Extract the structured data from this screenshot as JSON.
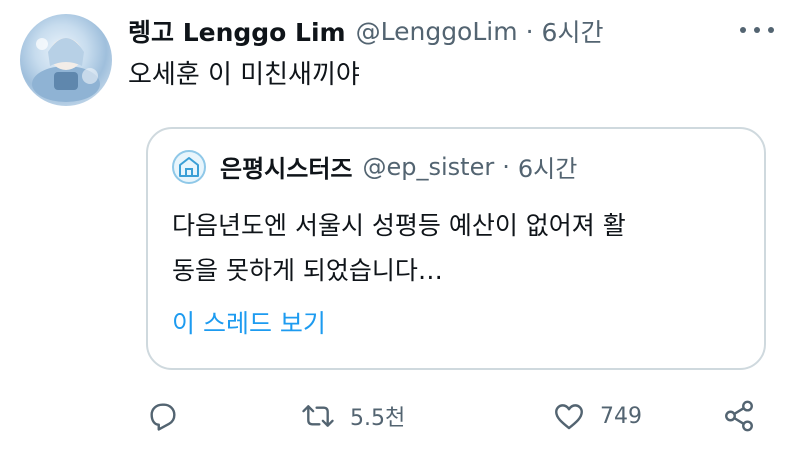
{
  "tweet": {
    "display_name": "렝고 Lenggo Lim",
    "handle": "@LenggoLim",
    "separator": "·",
    "time": "6시간",
    "text": "오세훈 이 미친새끼야"
  },
  "quote": {
    "display_name": "은평시스터즈",
    "handle": "@ep_sister",
    "separator": "·",
    "time": "6시간",
    "text_line1": "다음년도엔 서울시 성평등 예산이 없어져  활",
    "text_line2": "동을 못하게 되었습니다…",
    "thread_link": "이 스레드 보기"
  },
  "actions": {
    "retweet_count": "5.5천",
    "like_count": "749"
  },
  "icons": {
    "more": "more-icon",
    "reply": "reply-icon",
    "retweet": "retweet-icon",
    "like": "heart-icon",
    "share": "share-icon"
  },
  "colors": {
    "text": "#0f1419",
    "secondary": "#536471",
    "link": "#1d9bf0",
    "border": "#cfd9de"
  }
}
